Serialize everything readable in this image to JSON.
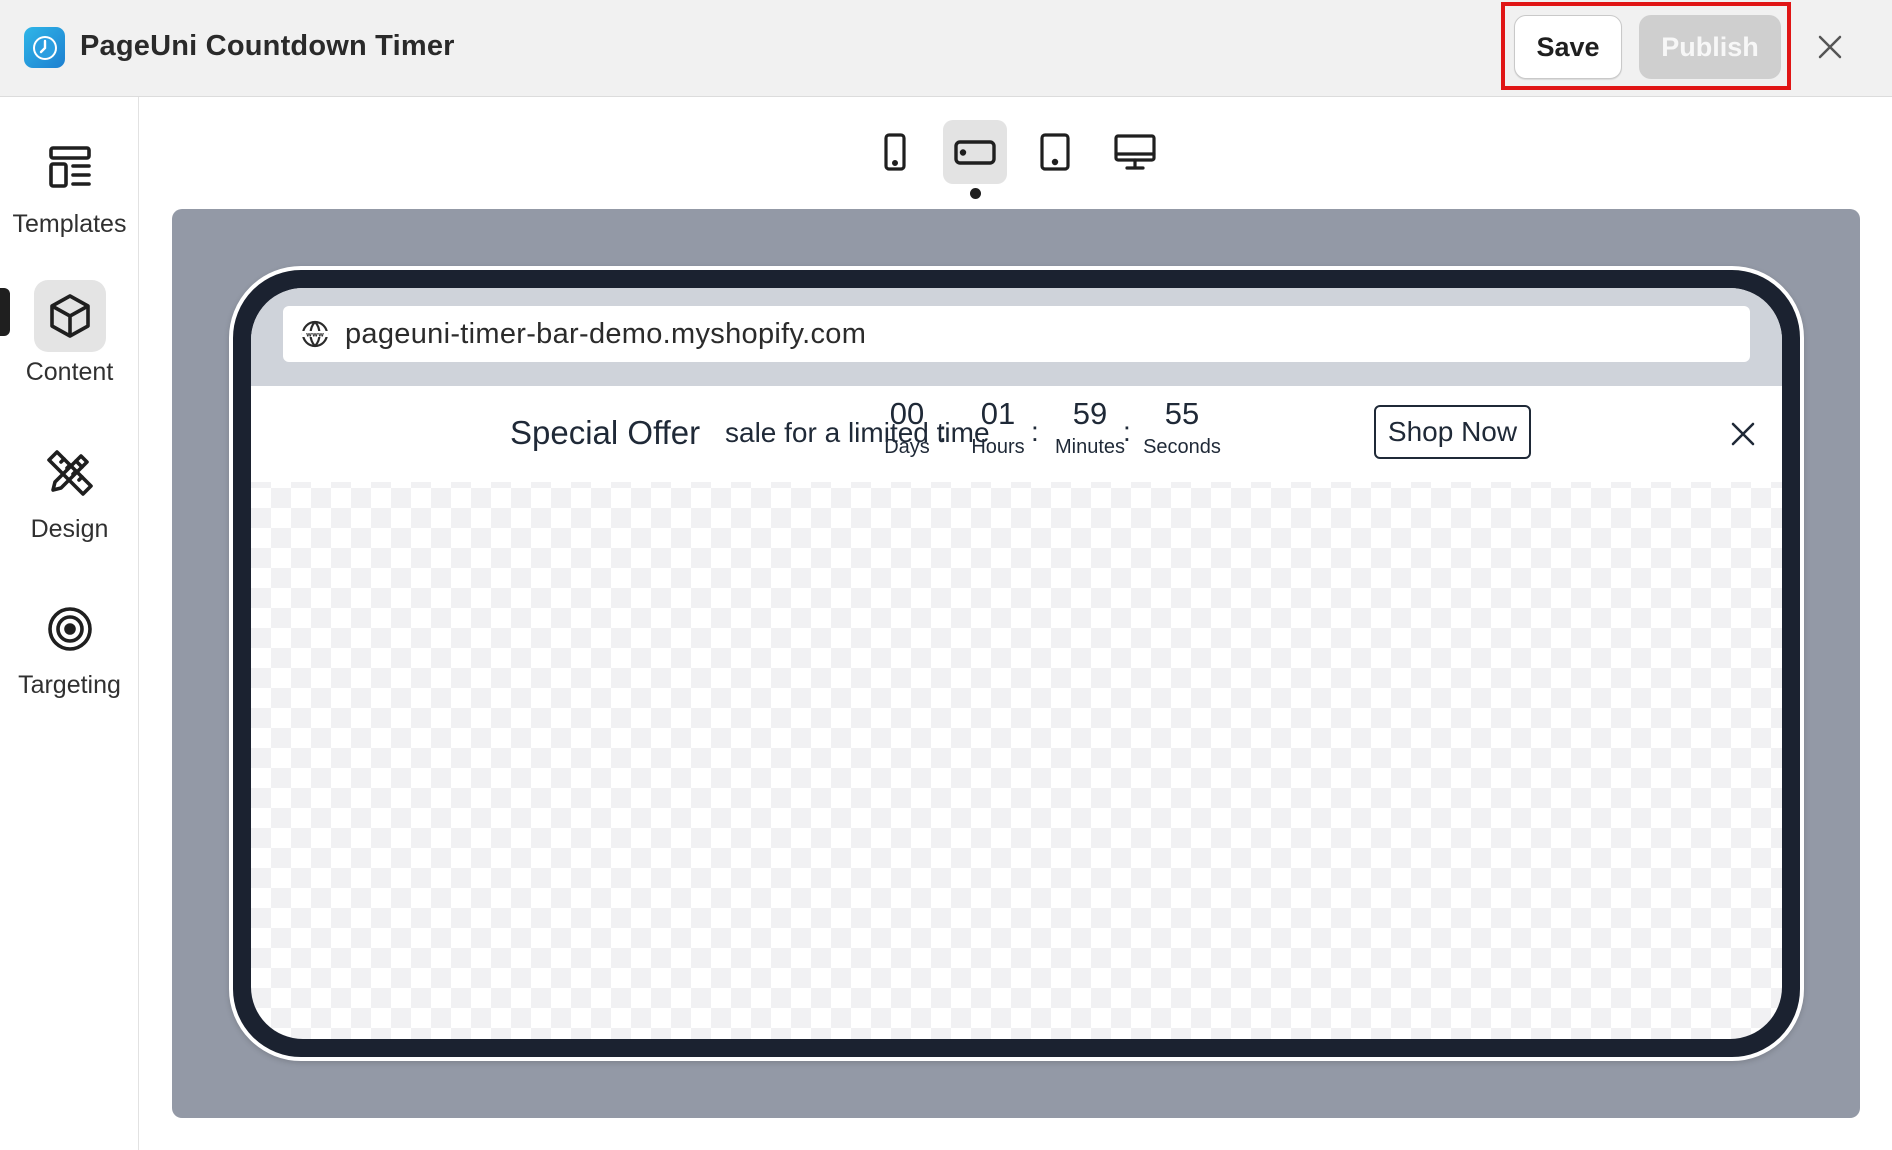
{
  "app": {
    "title": "PageUni Countdown Timer",
    "logo_icon": "clock-icon",
    "accent_color": "#1d7fd0"
  },
  "toolbar": {
    "save_label": "Save",
    "publish_label": "Publish",
    "close_icon": "close-icon",
    "highlight_color": "#e01515"
  },
  "sidebar": {
    "items": [
      {
        "label": "Templates",
        "icon": "templates-icon",
        "active": false
      },
      {
        "label": "Content",
        "icon": "cube-icon",
        "active": true
      },
      {
        "label": "Design",
        "icon": "pencil-ruler-icon",
        "active": false
      },
      {
        "label": "Targeting",
        "icon": "target-icon",
        "active": false
      }
    ],
    "collapse_icon": "sidebar-toggle-icon"
  },
  "devices": [
    {
      "name": "mobile-portrait",
      "icon": "phone-icon",
      "active": false
    },
    {
      "name": "mobile-landscape",
      "icon": "phone-landscape-icon",
      "active": true
    },
    {
      "name": "tablet",
      "icon": "tablet-icon",
      "active": false
    },
    {
      "name": "desktop",
      "icon": "desktop-icon",
      "active": false
    }
  ],
  "preview": {
    "url": "pageuni-timer-bar-demo.myshopify.com",
    "url_icon": "globe-www-icon",
    "timer_bar": {
      "title": "Special Offer",
      "subtitle": "sale for a limited time",
      "units": [
        {
          "value": "00",
          "label": "Days"
        },
        {
          "value": "01",
          "label": "Hours"
        },
        {
          "value": "59",
          "label": "Minutes"
        },
        {
          "value": "55",
          "label": "Seconds"
        }
      ],
      "separator": ":",
      "button_label": "Shop Now",
      "close_icon": "close-icon"
    }
  }
}
